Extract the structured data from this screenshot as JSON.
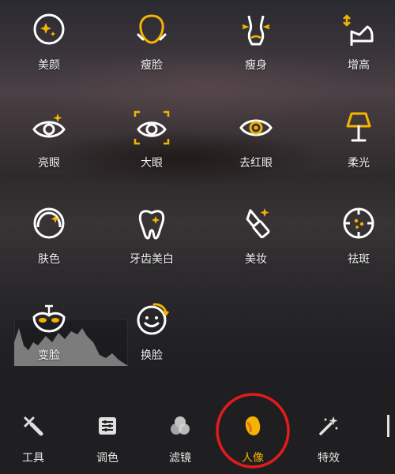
{
  "colors": {
    "accent": "#f5b400",
    "icon_white": "#ffffff",
    "highlight_circle": "#e21b1b",
    "bottom_bar": "#1f1f21"
  },
  "tools": [
    {
      "label": "美颜",
      "icon": "sparkle-face-icon"
    },
    {
      "label": "瘦脸",
      "icon": "face-contour-icon"
    },
    {
      "label": "瘦身",
      "icon": "body-slim-icon"
    },
    {
      "label": "增高",
      "icon": "high-heel-icon"
    },
    {
      "label": "亮眼",
      "icon": "sparkle-eye-icon"
    },
    {
      "label": "大眼",
      "icon": "eye-enlarge-icon"
    },
    {
      "label": "去红眼",
      "icon": "red-eye-icon"
    },
    {
      "label": "柔光",
      "icon": "lamp-icon"
    },
    {
      "label": "肤色",
      "icon": "skin-tone-icon"
    },
    {
      "label": "牙齿美白",
      "icon": "tooth-icon"
    },
    {
      "label": "美妆",
      "icon": "lipstick-icon"
    },
    {
      "label": "祛斑",
      "icon": "spot-target-icon"
    },
    {
      "label": "变脸",
      "icon": "mask-icon"
    },
    {
      "label": "换脸",
      "icon": "face-swap-icon"
    }
  ],
  "tabs": [
    {
      "label": "工具",
      "icon": "tools-icon",
      "active": false
    },
    {
      "label": "调色",
      "icon": "adjust-sliders-icon",
      "active": false
    },
    {
      "label": "滤镜",
      "icon": "filter-circles-icon",
      "active": false
    },
    {
      "label": "人像",
      "icon": "portrait-icon",
      "active": true
    },
    {
      "label": "特效",
      "icon": "magic-wand-icon",
      "active": false
    }
  ]
}
